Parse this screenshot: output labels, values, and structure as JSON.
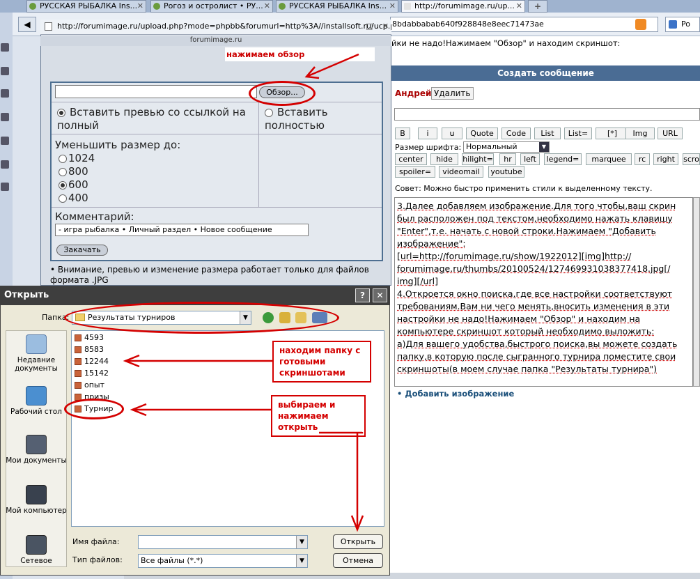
{
  "browser": {
    "tabs": [
      {
        "label": "РУССКАЯ РЫБАЛКА Ins..."
      },
      {
        "label": "Рогоз и остролист • РУ..."
      },
      {
        "label": "РУССКАЯ РЫБАЛКА Ins..."
      },
      {
        "label": "http://forumimage.ru/up..."
      }
    ],
    "new_tab": "+",
    "url": "8bdabbabab640f928848e8eec71473ae",
    "search_prefix": "Po"
  },
  "page": {
    "intro": "йки не надо!Нажимаем \"Обзор\" и находим скриншот:",
    "header": "Создать сообщение",
    "author": "Андрей",
    "delete_label": "Удалить",
    "toolbar_row1": [
      "B",
      "i",
      "u",
      "Quote",
      "Code",
      "List",
      "List=",
      "[*]",
      "Img",
      "URL"
    ],
    "font_size_label": "Размер шрифта:",
    "font_size_value": "Нормальный",
    "toolbar_row2": [
      "center",
      "hide",
      "hilight=",
      "hr",
      "left",
      "legend=",
      "marquee",
      "rc",
      "right",
      "scro"
    ],
    "toolbar_row3": [
      "spoiler=",
      "videomail",
      "youtube"
    ],
    "tip": "Совет: Можно быстро применить стили к выделенному тексту.",
    "message_lines": [
      "3.Далее добавляем изображение.Для того чтобы,ваш скрин",
      "был расположен под текстом,необходимо нажать клавишу",
      "\"Enter\",т.е. начать с новой строки.Нажимаем \"Добавить",
      "изображение\":",
      "[url=http://forumimage.ru/show/1922012][img]http://",
      "forumimage.ru/thumbs/20100524/127469931038377418.jpg[/",
      "img][/url]",
      "4.Откроется окно поиска,где все настройки соответствуют",
      "требованиям.Вам ни чего менять,вносить изменения в эти",
      "настройки не надо!Нажимаем \"Обзор\" и находим на",
      "компьютере скриншот который необходимо выложить:",
      "а)Для вашего удобства,быстрого поиска,вы можете создать",
      "папку,в которую после сыгранного турнира поместите свои",
      "скриншоты(в моем случае папка \"Результаты турнира\")"
    ],
    "add_image": "• Добавить изображение"
  },
  "popup": {
    "title": "http://forumimage.ru/upload.php?mode=phpbb&forumurl=http%3A//installsoft.ru/ucp.p...",
    "controls": "□ ✕",
    "site": "forumimage.ru",
    "browse_label": "Обзор...",
    "insert_preview": "Вставить превью со ссылкой на полный",
    "insert_full": "Вставить полностью",
    "resize_label": "Уменьшить размер до:",
    "sizes": [
      "1024",
      "800",
      "600",
      "400"
    ],
    "selected_size": "600",
    "comment_label": "Комментарий:",
    "comment_value": "- игра рыбалка • Личный раздел • Новое сообщение",
    "upload_label": "Закачать",
    "notice": "• Внимание, превью и изменение размера работает только для файлов формата .JPG"
  },
  "dialog": {
    "title": "Открыть",
    "help": "?",
    "close": "✕",
    "lookin_label": "Папка:",
    "lookin_value": "Результаты турниров",
    "places": [
      "Недавние документы",
      "Рабочий стол",
      "Мои документы",
      "Мой компьютер",
      "Сетевое"
    ],
    "files": [
      "4593",
      "8583",
      "12244",
      "15142",
      "опыт",
      "призы",
      "Турнир"
    ],
    "filename_label": "Имя файла:",
    "filetype_label": "Тип файлов:",
    "filetype_value": "Все файлы (*.*)",
    "open_label": "Открыть",
    "cancel_label": "Отмена"
  },
  "annotations": {
    "browse_note": "нажимаем обзор",
    "folder_note": "находим папку с готовыми скриншотами",
    "select_note": "выбираем и нажимаем открыть",
    "color": "#d40000"
  }
}
